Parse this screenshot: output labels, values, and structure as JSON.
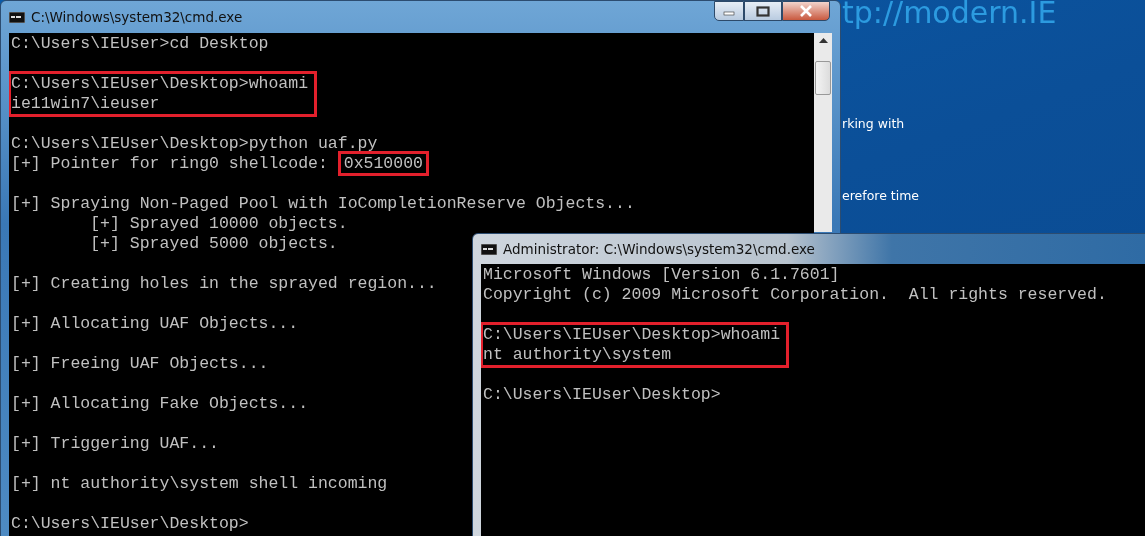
{
  "desktop": {
    "texts": [
      {
        "kind": "heading",
        "text": "tp://modern.IE"
      },
      {
        "kind": "body",
        "text": "rking with"
      },
      {
        "kind": "body",
        "text": "erefore time"
      }
    ]
  },
  "windows": [
    {
      "title": "C:\\Windows\\system32\\cmd.exe",
      "caption_buttons": true,
      "scrollbar": true,
      "lines": [
        {
          "kind": "text",
          "text": "C:\\Users\\IEUser>cd Desktop"
        },
        {
          "kind": "blank"
        },
        {
          "kind": "group",
          "lines": [
            "C:\\Users\\IEUser\\Desktop>whoami",
            "ie11win7\\ieuser"
          ]
        },
        {
          "kind": "blank"
        },
        {
          "kind": "text",
          "text": "C:\\Users\\IEUser\\Desktop>python uaf.py"
        },
        {
          "kind": "mark",
          "text": "[+] Pointer for ring0 shellcode: ",
          "marked": "0x510000"
        },
        {
          "kind": "blank"
        },
        {
          "kind": "text",
          "text": "[+] Spraying Non-Paged Pool with IoCompletionReserve Objects..."
        },
        {
          "kind": "text",
          "text": "        [+] Sprayed 10000 objects."
        },
        {
          "kind": "text",
          "text": "        [+] Sprayed 5000 objects."
        },
        {
          "kind": "blank"
        },
        {
          "kind": "text",
          "text": "[+] Creating holes in the sprayed region..."
        },
        {
          "kind": "blank"
        },
        {
          "kind": "text",
          "text": "[+] Allocating UAF Objects..."
        },
        {
          "kind": "blank"
        },
        {
          "kind": "text",
          "text": "[+] Freeing UAF Objects..."
        },
        {
          "kind": "blank"
        },
        {
          "kind": "text",
          "text": "[+] Allocating Fake Objects..."
        },
        {
          "kind": "blank"
        },
        {
          "kind": "text",
          "text": "[+] Triggering UAF..."
        },
        {
          "kind": "blank"
        },
        {
          "kind": "text",
          "text": "[+] nt authority\\system shell incoming"
        },
        {
          "kind": "blank"
        },
        {
          "kind": "text",
          "text": "C:\\Users\\IEUser\\Desktop>"
        }
      ]
    },
    {
      "title": "Administrator: C:\\Windows\\system32\\cmd.exe",
      "caption_buttons": false,
      "scrollbar": false,
      "lines": [
        {
          "kind": "text",
          "text": "Microsoft Windows [Version 6.1.7601]"
        },
        {
          "kind": "text",
          "text": "Copyright (c) 2009 Microsoft Corporation.  All rights reserved."
        },
        {
          "kind": "blank"
        },
        {
          "kind": "group",
          "lines": [
            "C:\\Users\\IEUser\\Desktop>whoami",
            "nt authority\\system"
          ]
        },
        {
          "kind": "blank"
        },
        {
          "kind": "text",
          "text": "C:\\Users\\IEUser\\Desktop>"
        }
      ]
    }
  ]
}
